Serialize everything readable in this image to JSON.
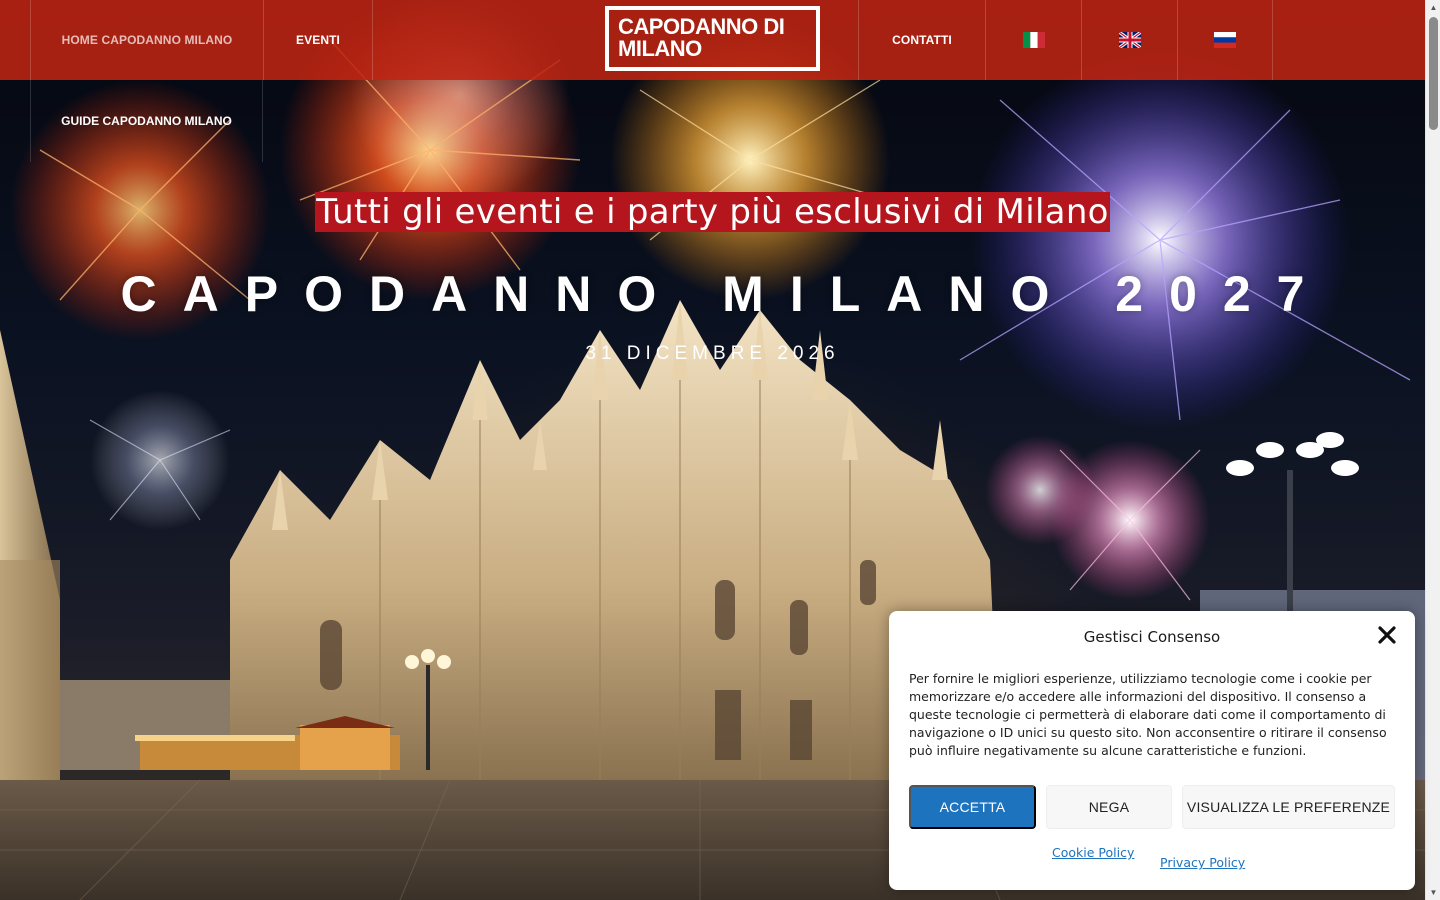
{
  "nav": {
    "home_label": "HOME CAPODANNO MILANO",
    "events_label": "EVENTI",
    "contacts_label": "CONTATTI",
    "guide_label": "GUIDE CAPODANNO MILANO",
    "logo_line1": "CAPODANNO DI",
    "logo_line2": "MILANO",
    "flags": [
      "flag-italy-icon",
      "flag-uk-icon",
      "flag-russia-icon"
    ]
  },
  "hero": {
    "tagline": "Tutti gli eventi e i party più esclusivi di Milano",
    "title": "CAPODANNO MILANO 2027",
    "date": "31 DICEMBRE 2026"
  },
  "consent": {
    "title": "Gestisci Consenso",
    "body": "Per fornire le migliori esperienze, utilizziamo tecnologie come i cookie per memorizzare e/o accedere alle informazioni del dispositivo. Il consenso a queste tecnologie ci permetterà di elaborare dati come il comportamento di navigazione o ID unici su questo sito. Non acconsentire o ritirare il consenso può influire negativamente su alcune caratteristiche e funzioni.",
    "accept_label": "ACCETTA",
    "deny_label": "NEGA",
    "prefs_label": "VISUALIZZA LE PREFERENZE",
    "cookie_policy_label": "Cookie Policy",
    "privacy_policy_label": "Privacy Policy"
  },
  "colors": {
    "nav_red": "#be2412",
    "tagline_red": "#b5151d",
    "accept_blue": "#1e73be"
  }
}
